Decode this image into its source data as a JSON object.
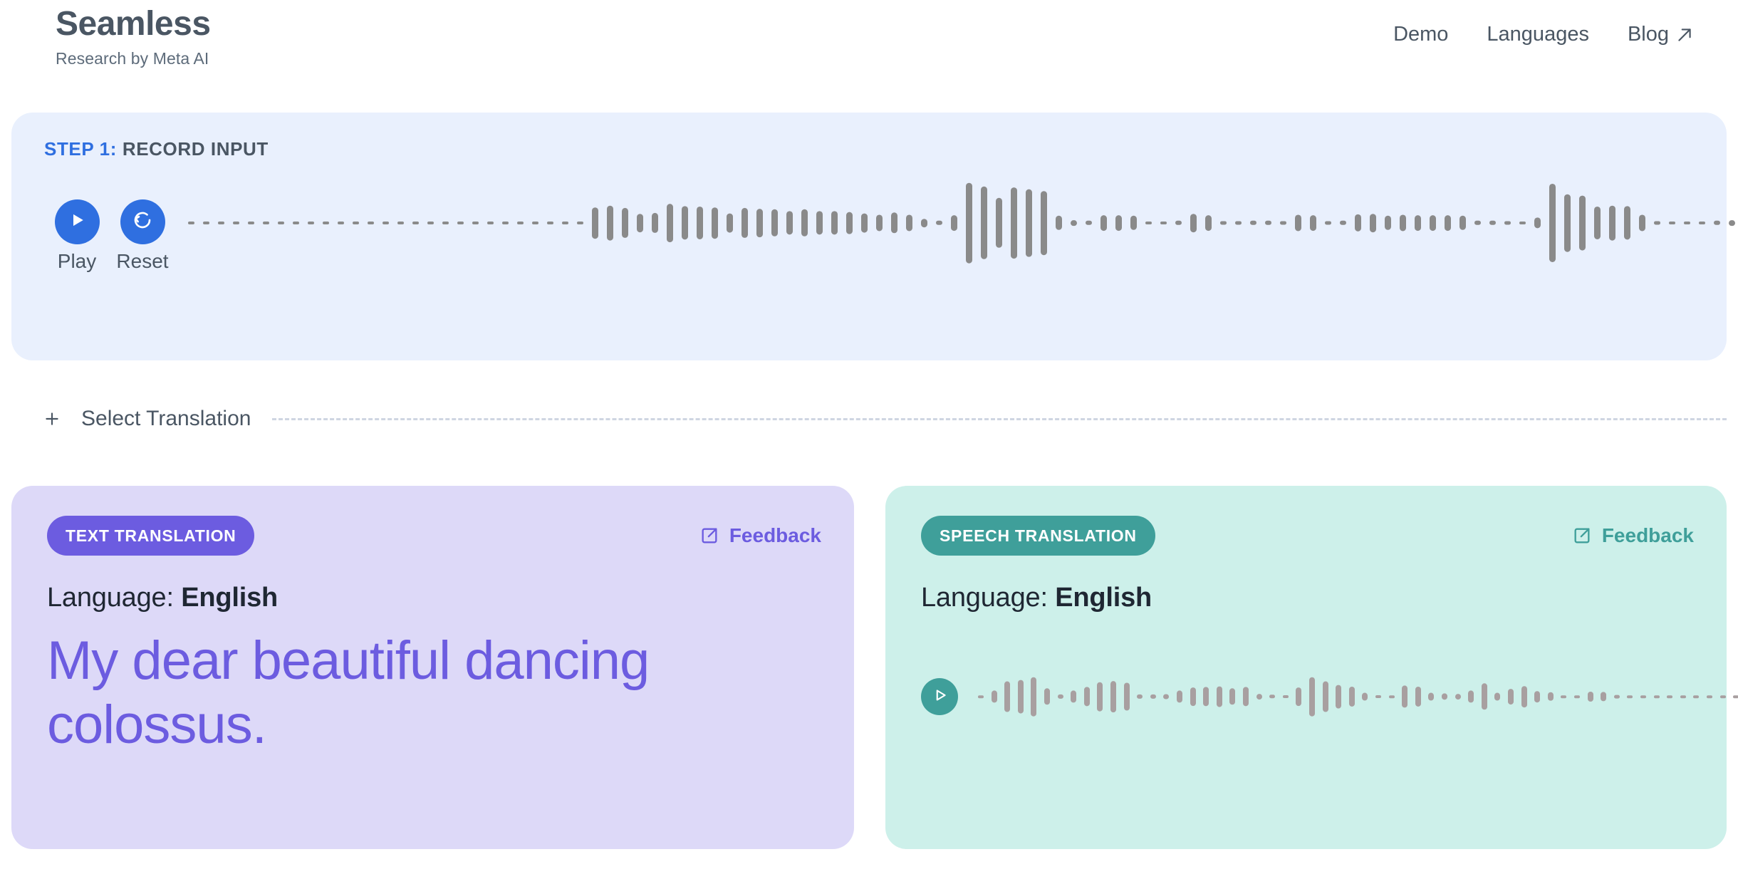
{
  "header": {
    "brand_title": "Seamless",
    "brand_subtitle": "Research by Meta AI",
    "nav": [
      {
        "label": "Demo",
        "icon": ""
      },
      {
        "label": "Languages",
        "icon": ""
      },
      {
        "label": "Blog",
        "icon": "external-link-arrow-icon"
      }
    ]
  },
  "step_panel": {
    "step_number": "STEP 1:",
    "step_title": "RECORD INPUT",
    "accent_color": "#2f6fe0",
    "background_color": "#e9f0fd",
    "controls": [
      {
        "label": "Play",
        "icon": "play-icon"
      },
      {
        "label": "Reset",
        "icon": "reset-icon"
      }
    ],
    "waveform": {
      "bar_color": "#8a8a8a",
      "amplitudes": [
        0.02,
        0.02,
        0.02,
        0.02,
        0.02,
        0.02,
        0.02,
        0.02,
        0.02,
        0.02,
        0.02,
        0.02,
        0.02,
        0.02,
        0.02,
        0.02,
        0.02,
        0.02,
        0.02,
        0.02,
        0.02,
        0.02,
        0.02,
        0.02,
        0.02,
        0.02,
        0.03,
        0.34,
        0.38,
        0.33,
        0.2,
        0.22,
        0.42,
        0.37,
        0.36,
        0.34,
        0.21,
        0.33,
        0.31,
        0.3,
        0.26,
        0.3,
        0.26,
        0.26,
        0.24,
        0.21,
        0.18,
        0.23,
        0.18,
        0.09,
        0.05,
        0.17,
        0.88,
        0.8,
        0.55,
        0.78,
        0.74,
        0.7,
        0.16,
        0.06,
        0.05,
        0.17,
        0.17,
        0.16,
        0.03,
        0.03,
        0.05,
        0.2,
        0.17,
        0.04,
        0.04,
        0.05,
        0.05,
        0.04,
        0.18,
        0.17,
        0.04,
        0.05,
        0.19,
        0.2,
        0.16,
        0.18,
        0.17,
        0.17,
        0.17,
        0.16,
        0.05,
        0.05,
        0.04,
        0.03,
        0.12,
        0.86,
        0.63,
        0.6,
        0.36,
        0.38,
        0.37,
        0.18,
        0.04,
        0.02,
        0.02,
        0.02,
        0.05,
        0.06,
        0.04,
        0.02,
        0.02,
        0.02,
        0.02
      ]
    }
  },
  "select_translation": {
    "label": "Select Translation",
    "icon": "plus-icon"
  },
  "results": {
    "text_panel": {
      "badge": "Text Translation",
      "badge_color": "#6c5ce0",
      "background_color": "#ddd9f8",
      "feedback_label": "Feedback",
      "feedback_icon": "external-link-box-icon",
      "language_label": "Language:",
      "language_value": "English",
      "translation": "My dear beautiful dancing colossus."
    },
    "speech_panel": {
      "badge": "Speech Translation",
      "badge_color": "#3f9f9a",
      "background_color": "#cdf0ea",
      "feedback_label": "Feedback",
      "feedback_icon": "external-link-box-icon",
      "language_label": "Language:",
      "language_value": "English",
      "play_icon": "play-icon",
      "waveform": {
        "bar_color": "#a89fa0",
        "amplitudes": [
          0.04,
          0.22,
          0.55,
          0.6,
          0.7,
          0.3,
          0.08,
          0.22,
          0.35,
          0.52,
          0.56,
          0.5,
          0.08,
          0.08,
          0.09,
          0.22,
          0.33,
          0.35,
          0.37,
          0.3,
          0.35,
          0.1,
          0.07,
          0.05,
          0.33,
          0.7,
          0.55,
          0.42,
          0.36,
          0.14,
          0.05,
          0.04,
          0.4,
          0.36,
          0.14,
          0.12,
          0.1,
          0.22,
          0.48,
          0.14,
          0.28,
          0.38,
          0.2,
          0.16,
          0.04,
          0.04,
          0.18,
          0.17,
          0.06,
          0.02,
          0.02,
          0.02,
          0.02,
          0.02,
          0.02,
          0.02,
          0.02,
          0.02,
          0.02,
          0.02,
          0.02,
          0.02,
          0.02,
          0.02
        ]
      }
    }
  }
}
